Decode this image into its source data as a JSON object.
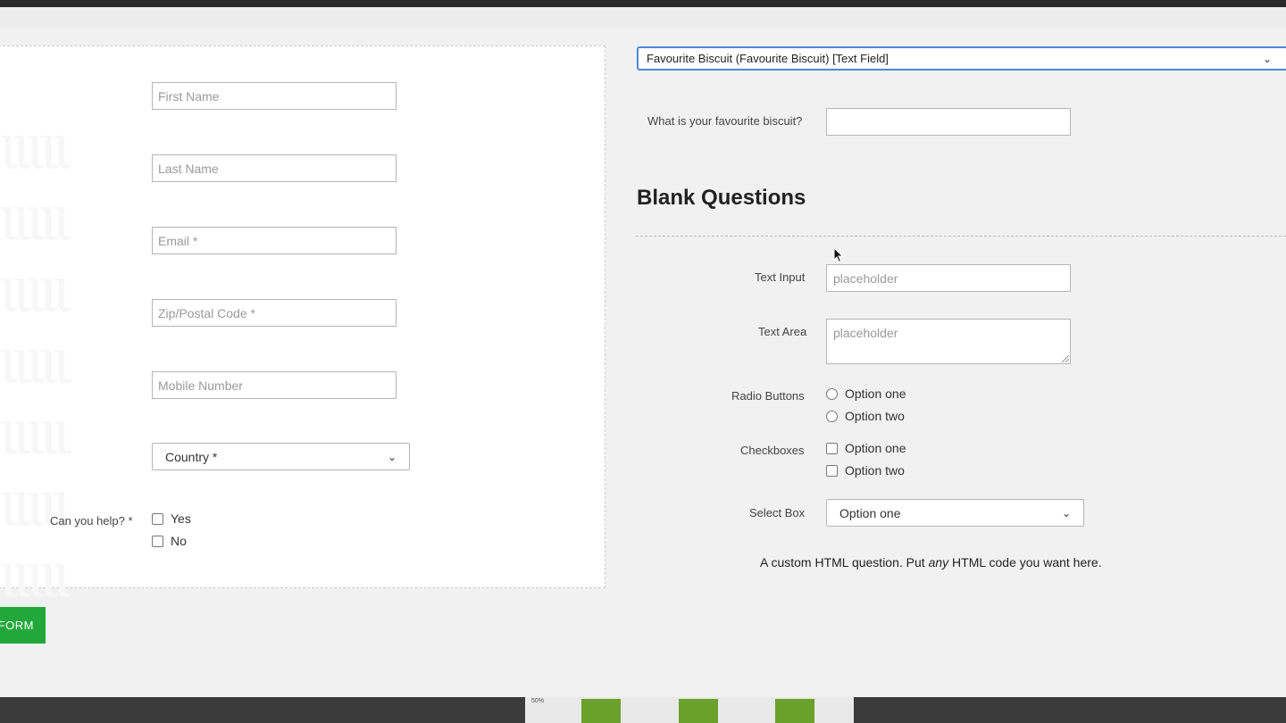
{
  "form": {
    "fields": {
      "first_name": "First Name",
      "last_name": "Last Name",
      "email": "Email *",
      "zip": "Zip/Postal Code *",
      "mobile": "Mobile Number"
    },
    "country_select": "Country *",
    "help_question": {
      "label": "Can you help? *",
      "options": [
        "Yes",
        "No"
      ]
    },
    "submit_label": "FORM"
  },
  "editor": {
    "field_selector": "Favourite Biscuit (Favourite Biscuit) [Text Field]",
    "biscuit_question": "What is your favourite biscuit?",
    "section_title": "Blank Questions",
    "text_input": {
      "label": "Text Input",
      "placeholder": "placeholder"
    },
    "text_area": {
      "label": "Text Area",
      "placeholder": "placeholder"
    },
    "radio_buttons": {
      "label": "Radio Buttons",
      "options": [
        "Option one",
        "Option two"
      ]
    },
    "checkboxes": {
      "label": "Checkboxes",
      "options": [
        "Option one",
        "Option two"
      ]
    },
    "select_box": {
      "label": "Select Box",
      "value": "Option one"
    },
    "custom_html": {
      "before": "A custom HTML question. Put ",
      "emphasis": "any",
      "after": " HTML code you want here."
    }
  },
  "bottom": {
    "percent_label": "50%"
  },
  "colors": {
    "submit_green": "#22a83a",
    "focus_blue": "#4f86d8",
    "bar_green": "#6aa12a"
  }
}
